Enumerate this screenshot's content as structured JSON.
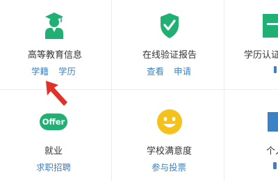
{
  "services": [
    {
      "title": "高等教育信息",
      "links": [
        "学籍",
        "学历"
      ],
      "icon": "graduate-icon"
    },
    {
      "title": "在线验证报告",
      "links": [
        "查看",
        "申请"
      ],
      "icon": "shield-check-icon"
    },
    {
      "title": "学历认证",
      "links": [
        "",
        ""
      ],
      "icon": "certificate-icon"
    },
    {
      "title": "就业",
      "links": [
        "求职招聘"
      ],
      "icon": "offer-icon",
      "icon_text": "Offer"
    },
    {
      "title": "学校满意度",
      "links": [
        "参与投票"
      ],
      "icon": "smiley-icon"
    },
    {
      "title": "个人",
      "links": [
        ""
      ],
      "icon": "person-icon"
    }
  ],
  "annotation": {
    "icon": "red-pointer-arrow-icon"
  },
  "colors": {
    "green": "#21b074",
    "link_blue": "#3b82c4",
    "smiley_yellow": "#f5c21b",
    "pointer_red": "#e0312b",
    "grid_line": "#ececec"
  }
}
